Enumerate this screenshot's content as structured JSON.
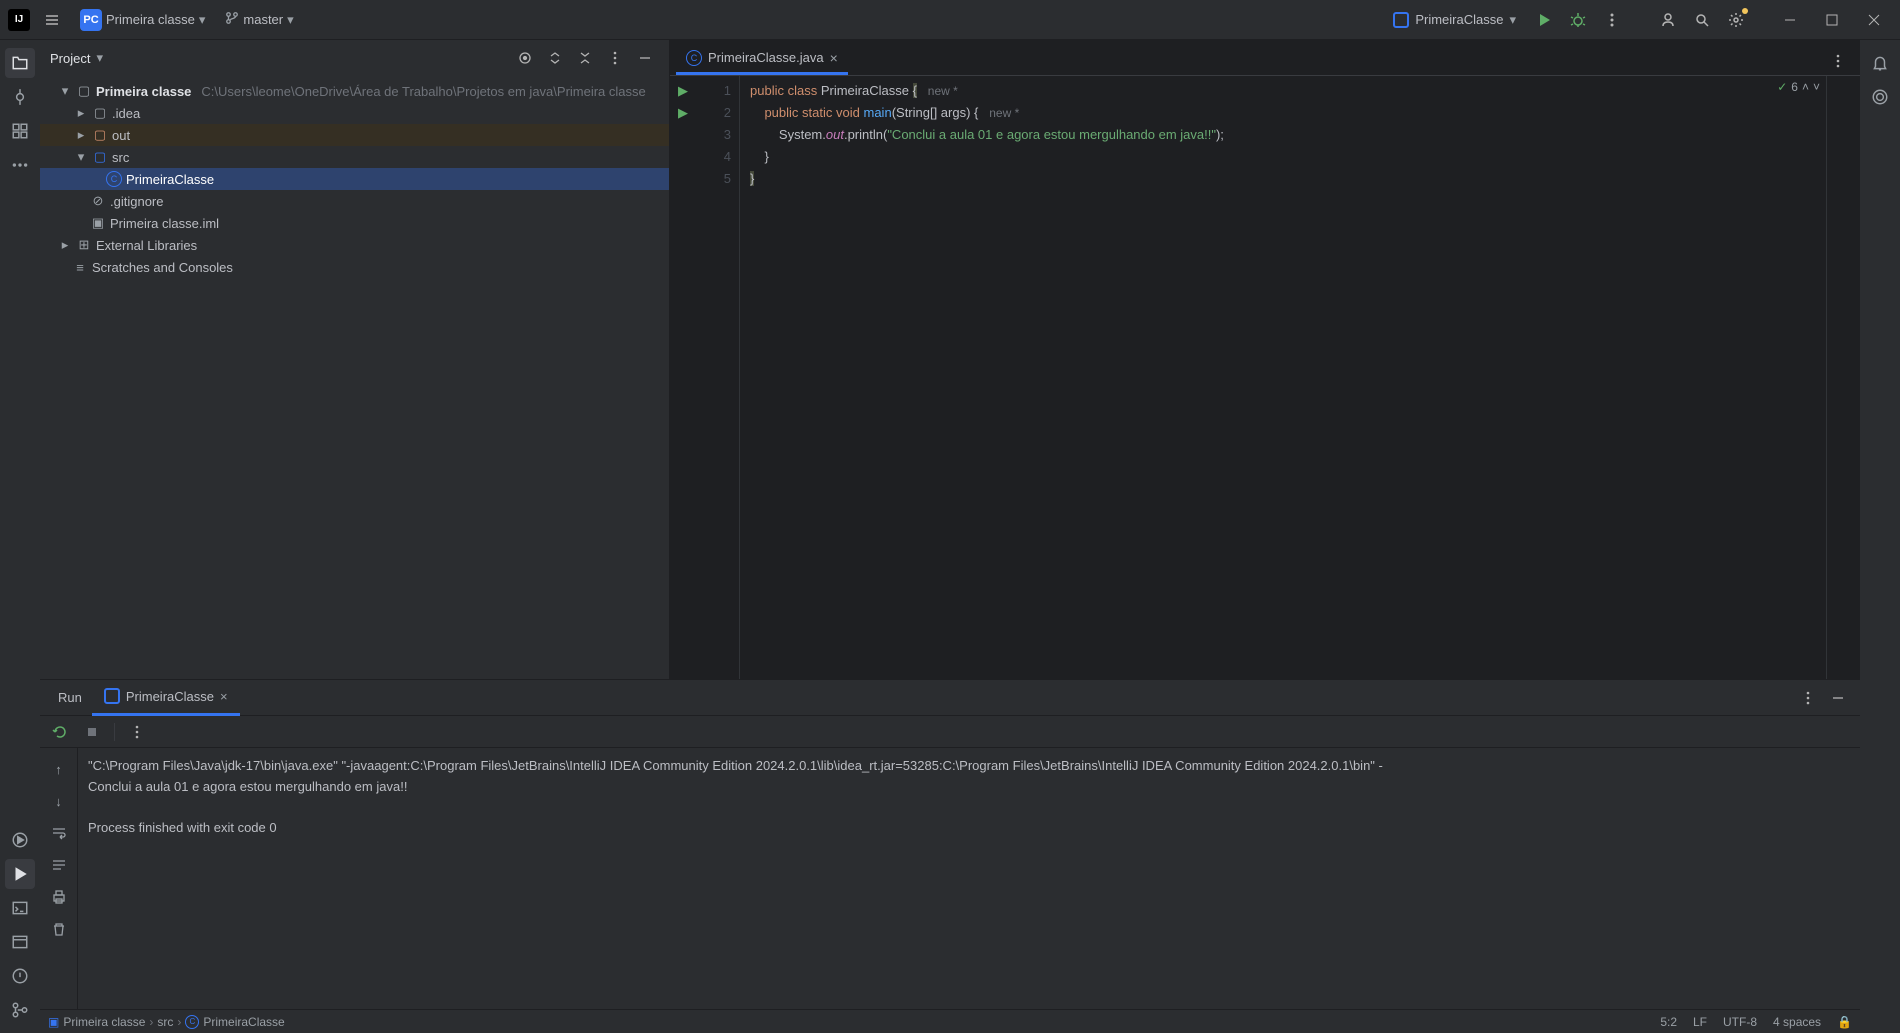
{
  "topbar": {
    "project_name": "Primeira classe",
    "branch": "master",
    "run_config": "PrimeiraClasse"
  },
  "project_panel": {
    "title": "Project",
    "tree": {
      "root": "Primeira classe",
      "root_path": "C:\\Users\\leome\\OneDrive\\Área de Trabalho\\Projetos em java\\Primeira classe",
      "idea": ".idea",
      "out": "out",
      "src": "src",
      "class_file": "PrimeiraClasse",
      "gitignore": ".gitignore",
      "iml": "Primeira classe.iml",
      "ext_lib": "External Libraries",
      "scratches": "Scratches and Consoles"
    }
  },
  "editor": {
    "tab_file": "PrimeiraClasse.java",
    "warning_count": "6",
    "code": {
      "l1_kw1": "public",
      "l1_kw2": "class",
      "l1_cls": "PrimeiraClasse",
      "l1_brace": "{",
      "l1_hint": "new *",
      "l2_kw1": "public",
      "l2_kw2": "static",
      "l2_kw3": "void",
      "l2_method": "main",
      "l2_rest": "(String[] args) {",
      "l2_hint": "new *",
      "l3_pre": "System.",
      "l3_field": "out",
      "l3_mid": ".println(",
      "l3_str": "\"Conclui a aula 01 e agora estou mergulhando em java!!\"",
      "l3_end": ");",
      "l4": "}",
      "l5": "}"
    }
  },
  "run": {
    "title": "Run",
    "tab": "PrimeiraClasse",
    "console_line1": "\"C:\\Program Files\\Java\\jdk-17\\bin\\java.exe\" \"-javaagent:C:\\Program Files\\JetBrains\\IntelliJ IDEA Community Edition 2024.2.0.1\\lib\\idea_rt.jar=53285:C:\\Program Files\\JetBrains\\IntelliJ IDEA Community Edition 2024.2.0.1\\bin\" -",
    "console_line2": "Conclui a aula 01 e agora estou mergulhando em java!!",
    "console_line3": "Process finished with exit code 0"
  },
  "breadcrumb": {
    "p0": "Primeira classe",
    "p1": "src",
    "p2": "PrimeiraClasse"
  },
  "statusbar": {
    "pos": "5:2",
    "eol": "LF",
    "encoding": "UTF-8",
    "indent": "4 spaces"
  }
}
